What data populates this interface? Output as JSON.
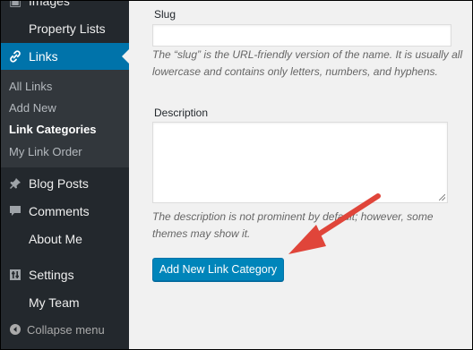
{
  "sidebar": {
    "items": [
      {
        "label": "Images",
        "icon": "images-icon"
      },
      {
        "label": "Property Lists",
        "icon": ""
      },
      {
        "label": "Links",
        "icon": "link-icon"
      },
      {
        "label": "Blog Posts",
        "icon": "pin-icon"
      },
      {
        "label": "Comments",
        "icon": "comment-icon"
      },
      {
        "label": "About Me",
        "icon": ""
      },
      {
        "label": "Settings",
        "icon": "settings-icon"
      },
      {
        "label": "My Team",
        "icon": ""
      }
    ],
    "submenu": [
      {
        "label": "All Links"
      },
      {
        "label": "Add New"
      },
      {
        "label": "Link Categories"
      },
      {
        "label": "My Link Order"
      }
    ],
    "collapse_label": "Collapse menu"
  },
  "form": {
    "slug": {
      "label": "Slug",
      "value": "",
      "hint": "The “slug” is the URL-friendly version of the name. It is usually all lowercase and contains only letters, numbers, and hyphens."
    },
    "description": {
      "label": "Description",
      "value": "",
      "hint": "The description is not prominent by default; however, some themes may show it."
    },
    "submit_label": "Add New Link Category"
  },
  "colors": {
    "sidebar_bg": "#23282d",
    "active_bg": "#0073aa",
    "button_bg": "#0085ba",
    "arrow": "#e0453a"
  }
}
